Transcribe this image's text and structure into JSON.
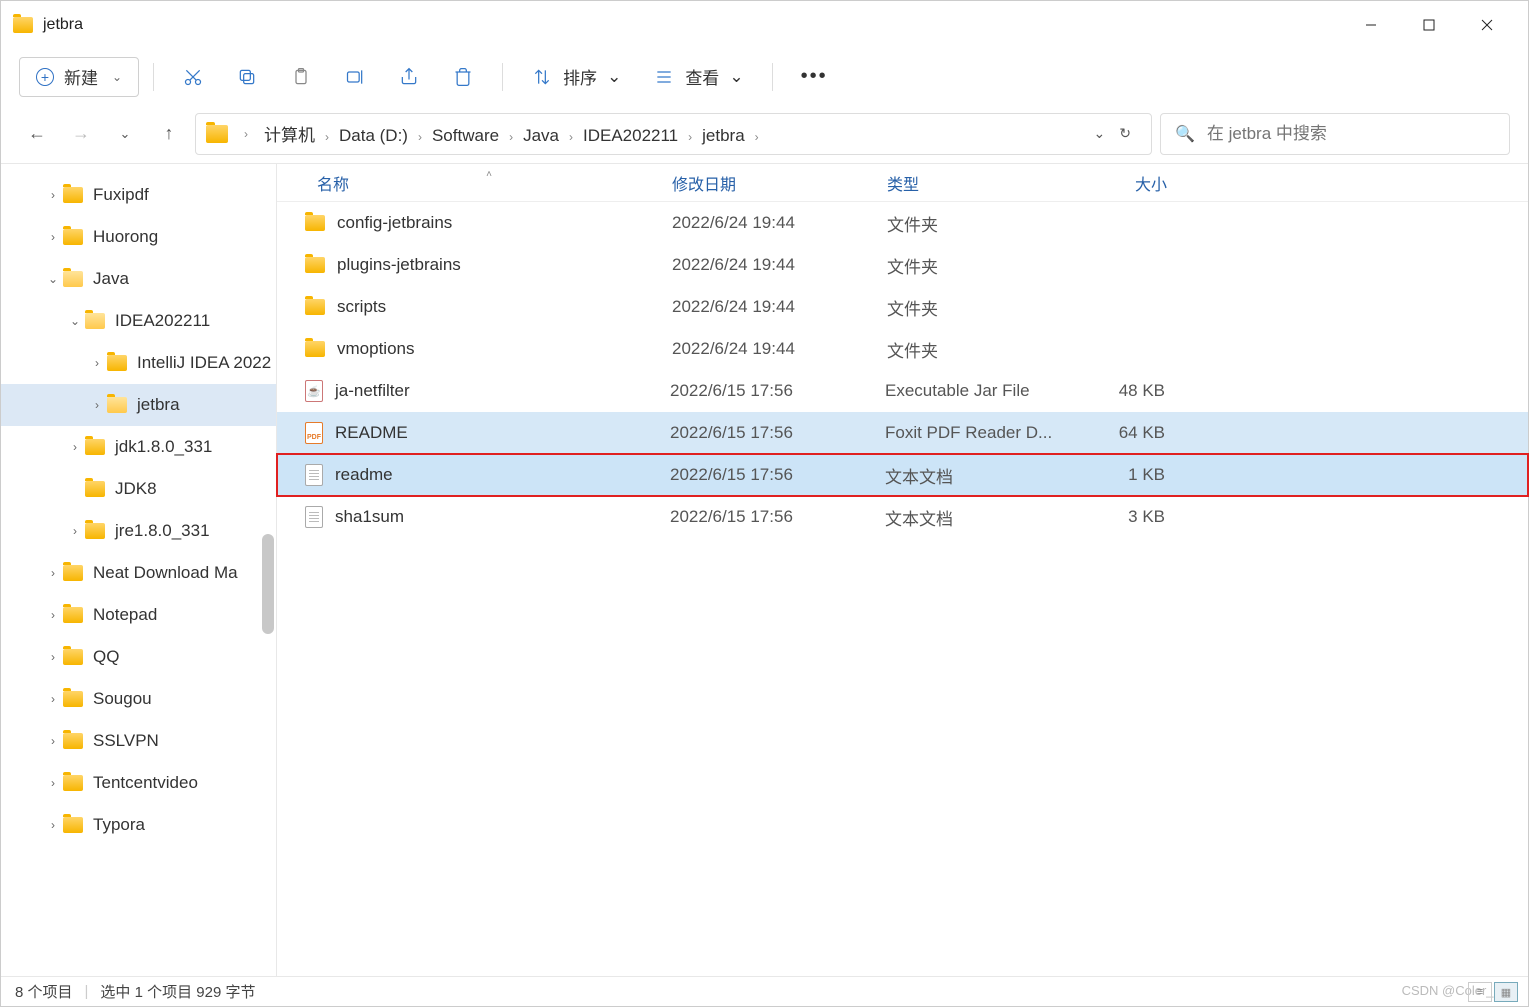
{
  "window": {
    "title": "jetbra"
  },
  "toolbar": {
    "new_label": "新建",
    "sort_label": "排序",
    "view_label": "查看"
  },
  "breadcrumb": {
    "items": [
      "计算机",
      "Data (D:)",
      "Software",
      "Java",
      "IDEA202211",
      "jetbra"
    ]
  },
  "search": {
    "placeholder": "在 jetbra 中搜索"
  },
  "tree": [
    {
      "label": "Fuxipdf",
      "depth": 1,
      "exp": "›",
      "open": false
    },
    {
      "label": "Huorong",
      "depth": 1,
      "exp": "›",
      "open": false
    },
    {
      "label": "Java",
      "depth": 1,
      "exp": "⌄",
      "open": true
    },
    {
      "label": "IDEA202211",
      "depth": 2,
      "exp": "⌄",
      "open": true
    },
    {
      "label": "IntelliJ IDEA 2022",
      "depth": 3,
      "exp": "›",
      "open": false
    },
    {
      "label": "jetbra",
      "depth": 3,
      "exp": "›",
      "open": true,
      "selected": true
    },
    {
      "label": "jdk1.8.0_331",
      "depth": 2,
      "exp": "›",
      "open": false
    },
    {
      "label": "JDK8",
      "depth": 2,
      "exp": "",
      "open": false
    },
    {
      "label": "jre1.8.0_331",
      "depth": 2,
      "exp": "›",
      "open": false
    },
    {
      "label": "Neat Download Ma",
      "depth": 1,
      "exp": "›",
      "open": false
    },
    {
      "label": "Notepad",
      "depth": 1,
      "exp": "›",
      "open": false
    },
    {
      "label": "QQ",
      "depth": 1,
      "exp": "›",
      "open": false
    },
    {
      "label": "Sougou",
      "depth": 1,
      "exp": "›",
      "open": false
    },
    {
      "label": "SSLVPN",
      "depth": 1,
      "exp": "›",
      "open": false
    },
    {
      "label": "Tentcentvideo",
      "depth": 1,
      "exp": "›",
      "open": false
    },
    {
      "label": "Typora",
      "depth": 1,
      "exp": "›",
      "open": false
    }
  ],
  "columns": {
    "name": "名称",
    "date": "修改日期",
    "type": "类型",
    "size": "大小"
  },
  "files": [
    {
      "icon": "folder",
      "name": "config-jetbrains",
      "date": "2022/6/24 19:44",
      "type": "文件夹",
      "size": ""
    },
    {
      "icon": "folder",
      "name": "plugins-jetbrains",
      "date": "2022/6/24 19:44",
      "type": "文件夹",
      "size": ""
    },
    {
      "icon": "folder",
      "name": "scripts",
      "date": "2022/6/24 19:44",
      "type": "文件夹",
      "size": ""
    },
    {
      "icon": "folder",
      "name": "vmoptions",
      "date": "2022/6/24 19:44",
      "type": "文件夹",
      "size": ""
    },
    {
      "icon": "jar",
      "name": "ja-netfilter",
      "date": "2022/6/15 17:56",
      "type": "Executable Jar File",
      "size": "48 KB"
    },
    {
      "icon": "pdf",
      "name": "README",
      "date": "2022/6/15 17:56",
      "type": "Foxit PDF Reader D...",
      "size": "64 KB",
      "hover": true
    },
    {
      "icon": "doc",
      "name": "readme",
      "date": "2022/6/15 17:56",
      "type": "文本文档",
      "size": "1 KB",
      "selected": true,
      "redbox": true
    },
    {
      "icon": "doc",
      "name": "sha1sum",
      "date": "2022/6/15 17:56",
      "type": "文本文档",
      "size": "3 KB"
    }
  ],
  "status": {
    "count": "8 个项目",
    "selected": "选中 1 个项目 929 字节"
  },
  "watermark": "CSDN @Coler_Lu"
}
